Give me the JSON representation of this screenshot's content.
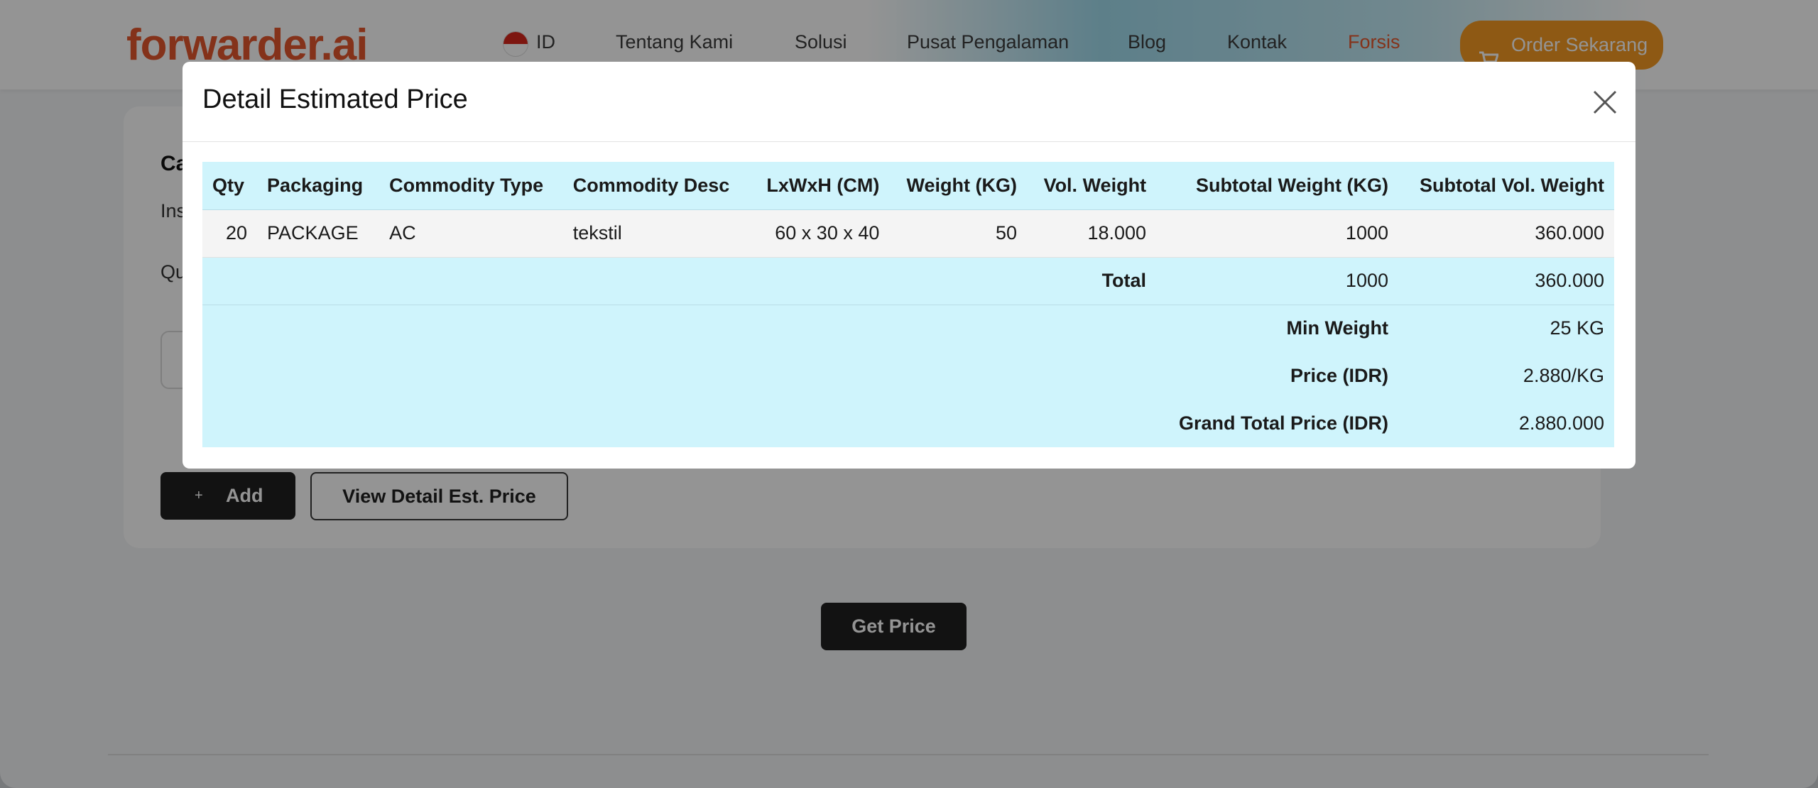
{
  "header": {
    "logo_text": "forwarder.ai",
    "language": "ID",
    "nav": [
      "Tentang Kami",
      "Solusi",
      "Pusat Pengalaman",
      "Blog",
      "Kontak",
      "Forsis"
    ],
    "order_button": "Order Sekarang",
    "accent_color": "#e4572e",
    "order_color": "#f59a23"
  },
  "form": {
    "title_partial": "Ca",
    "subtitle_partial": "Ins",
    "quantity_label_partial": "Qu",
    "add_button": "Add",
    "add_icon": "+",
    "view_detail_button": "View Detail Est. Price",
    "get_price_button": "Get Price"
  },
  "modal": {
    "title": "Detail Estimated Price",
    "close_icon": "close-icon",
    "header_bg": "#cff4fc",
    "columns": [
      "Qty",
      "Packaging",
      "Commodity Type",
      "Commodity Desc",
      "LxWxH (CM)",
      "Weight (KG)",
      "Vol. Weight",
      "Subtotal Weight (KG)",
      "Subtotal Vol. Weight"
    ],
    "rows": [
      {
        "qty": "20",
        "packaging": "PACKAGE",
        "commodity_type": "AC",
        "commodity_desc": "tekstil",
        "dimensions": "60 x 30 x 40",
        "weight": "50",
        "vol_weight": "18.000",
        "subtotal_weight": "1000",
        "subtotal_vol_weight": "360.000"
      }
    ],
    "total": {
      "label": "Total",
      "weight": "1000",
      "vol_weight": "360.000"
    },
    "summary": [
      {
        "label": "Min Weight",
        "value": "25 KG"
      },
      {
        "label": "Price (IDR)",
        "value": "2.880/KG"
      },
      {
        "label": "Grand Total Price (IDR)",
        "value": "2.880.000"
      }
    ]
  }
}
